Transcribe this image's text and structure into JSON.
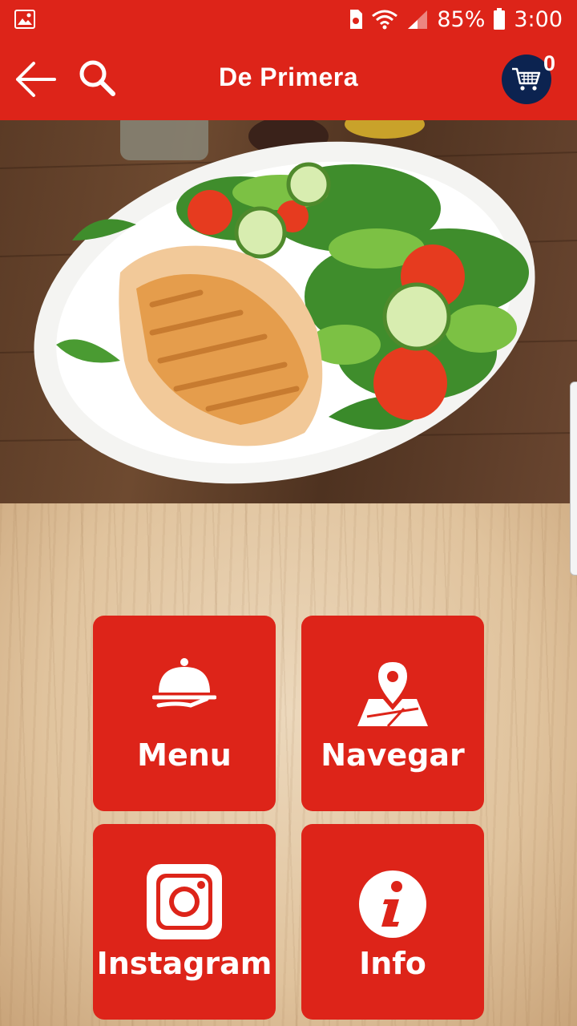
{
  "status_bar": {
    "battery": "85%",
    "time": "3:00",
    "icons": [
      "image-icon",
      "sim-icon",
      "wifi-icon",
      "signal-icon",
      "battery-icon"
    ]
  },
  "app_bar": {
    "title": "De Primera",
    "cart_count": "0",
    "icons": [
      "back-arrow-icon",
      "search-icon",
      "cart-icon"
    ]
  },
  "tiles": [
    {
      "label": "Menu",
      "icon": "cloche-icon"
    },
    {
      "label": "Navegar",
      "icon": "map-pin-icon"
    },
    {
      "label": "Instagram",
      "icon": "instagram-icon"
    },
    {
      "label": "Info",
      "icon": "info-icon"
    }
  ],
  "colors": {
    "primary": "#dd2419",
    "cart_badge": "#0c2350"
  }
}
